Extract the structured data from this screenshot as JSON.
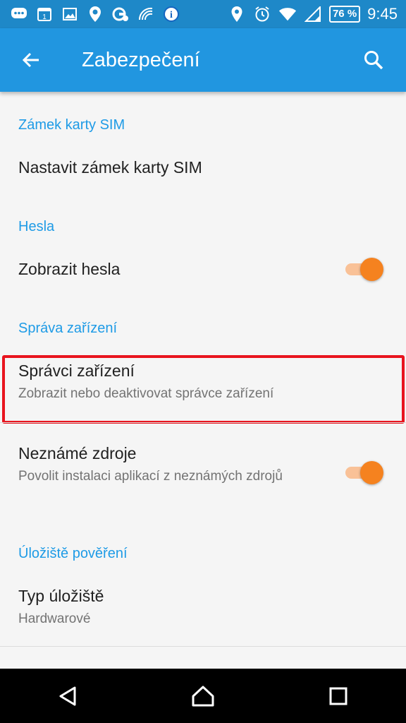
{
  "status_bar": {
    "battery": "76 %",
    "time": "9:45",
    "notification_badge": "1",
    "info_icon": "i",
    "colors": {
      "background": "#1e88c8"
    }
  },
  "app_bar": {
    "title": "Zabezpečení",
    "colors": {
      "background": "#2196e0"
    }
  },
  "sections": {
    "sim_lock": {
      "header": "Zámek karty SIM",
      "items": [
        {
          "title": "Nastavit zámek karty SIM"
        }
      ]
    },
    "passwords": {
      "header": "Hesla",
      "items": [
        {
          "title": "Zobrazit hesla",
          "toggle": true
        }
      ]
    },
    "device_admin": {
      "header": "Správa zařízení",
      "items": [
        {
          "title": "Správci zařízení",
          "summary": "Zobrazit nebo deaktivovat správce zařízení"
        },
        {
          "title": "Neznámé zdroje",
          "summary": "Povolit instalaci aplikací z neznámých zdrojů",
          "toggle": true
        }
      ]
    },
    "credential_storage": {
      "header": "Úložiště pověření",
      "items": [
        {
          "title": "Typ úložiště",
          "summary": "Hardwarové"
        }
      ]
    }
  },
  "accent_colors": {
    "section_header": "#1e9be6",
    "switch_thumb": "#f5821f",
    "highlight_border": "#e8141e"
  },
  "nav_bar": {
    "buttons": [
      "back-icon",
      "home-icon",
      "recents-icon"
    ]
  }
}
